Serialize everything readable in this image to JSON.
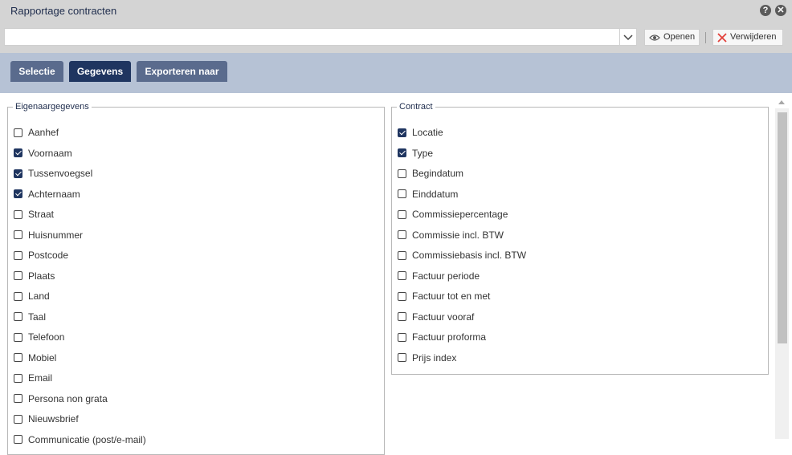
{
  "window": {
    "title": "Rapportage contracten",
    "help_icon": "help-icon",
    "close_icon": "close-icon"
  },
  "toolbar": {
    "selection_value": "",
    "open_label": "Openen",
    "delete_label": "Verwijderen"
  },
  "tabs": [
    {
      "label": "Selectie",
      "active": false
    },
    {
      "label": "Gegevens",
      "active": true
    },
    {
      "label": "Exporteren naar",
      "active": false
    }
  ],
  "owner": {
    "legend": "Eigenaargegevens",
    "items": [
      {
        "label": "Aanhef",
        "checked": false
      },
      {
        "label": "Voornaam",
        "checked": true
      },
      {
        "label": "Tussenvoegsel",
        "checked": true
      },
      {
        "label": "Achternaam",
        "checked": true
      },
      {
        "label": "Straat",
        "checked": false
      },
      {
        "label": "Huisnummer",
        "checked": false
      },
      {
        "label": "Postcode",
        "checked": false
      },
      {
        "label": "Plaats",
        "checked": false
      },
      {
        "label": "Land",
        "checked": false
      },
      {
        "label": "Taal",
        "checked": false
      },
      {
        "label": "Telefoon",
        "checked": false
      },
      {
        "label": "Mobiel",
        "checked": false
      },
      {
        "label": "Email",
        "checked": false
      },
      {
        "label": "Persona non grata",
        "checked": false
      },
      {
        "label": "Nieuwsbrief",
        "checked": false
      },
      {
        "label": "Communicatie (post/e-mail)",
        "checked": false
      }
    ]
  },
  "contract": {
    "legend": "Contract",
    "items": [
      {
        "label": "Locatie",
        "checked": true
      },
      {
        "label": "Type",
        "checked": true
      },
      {
        "label": "Begindatum",
        "checked": false
      },
      {
        "label": "Einddatum",
        "checked": false
      },
      {
        "label": "Commissiepercentage",
        "checked": false
      },
      {
        "label": "Commissie incl. BTW",
        "checked": false
      },
      {
        "label": "Commissiebasis incl. BTW",
        "checked": false
      },
      {
        "label": "Factuur periode",
        "checked": false
      },
      {
        "label": "Factuur tot en met",
        "checked": false
      },
      {
        "label": "Factuur vooraf",
        "checked": false
      },
      {
        "label": "Factuur proforma",
        "checked": false
      },
      {
        "label": "Prijs index",
        "checked": false
      }
    ]
  },
  "colors": {
    "accent": "#1f3560",
    "tab_inactive": "#5a6b8d",
    "tabbar_bg": "#b6c2d5",
    "titlebar_bg": "#d4d4d4",
    "delete_icon": "#e2403a"
  }
}
